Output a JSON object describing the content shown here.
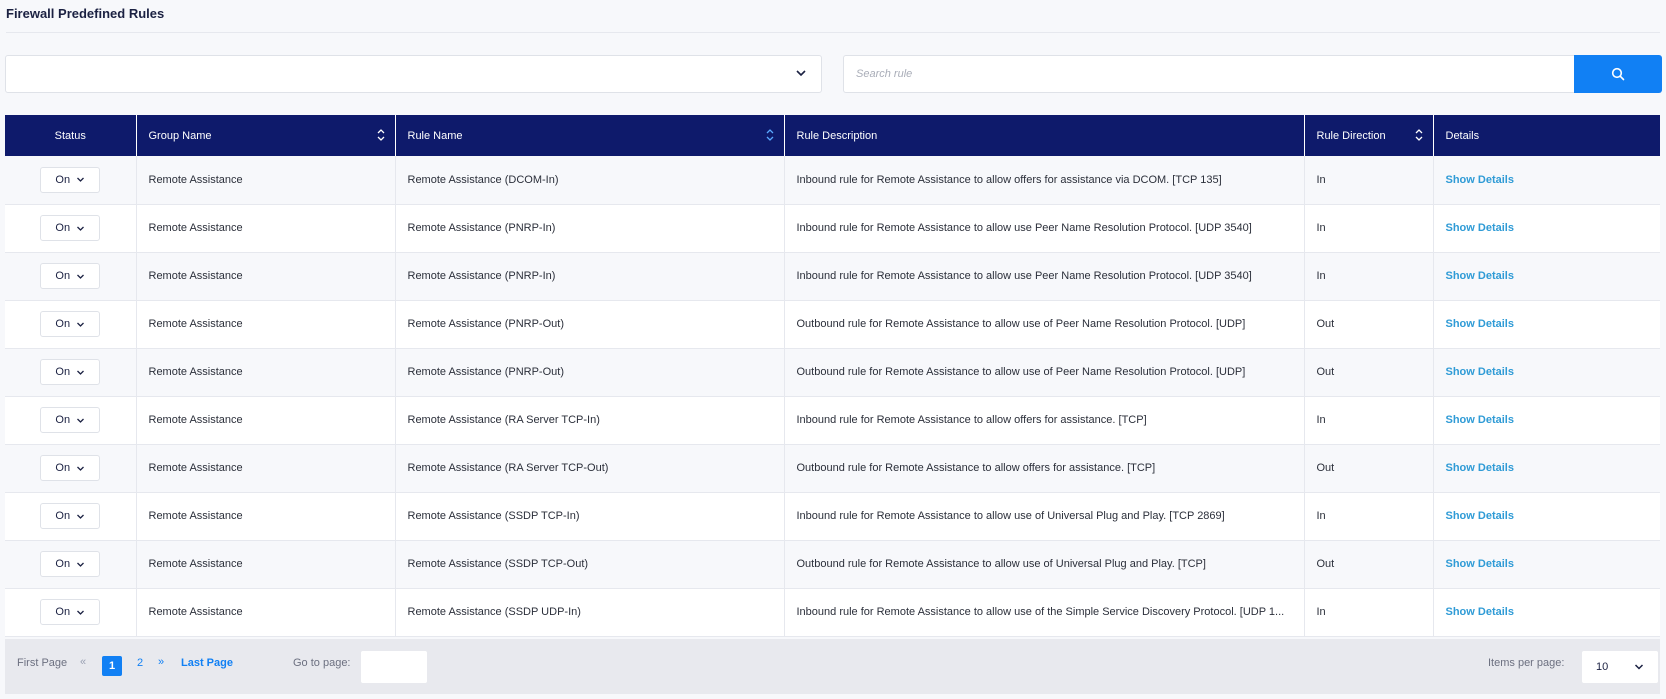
{
  "page": {
    "title": "Firewall Predefined Rules"
  },
  "filters": {
    "group_select_value": "",
    "search_placeholder": "Search rule",
    "search_icon": "search-icon"
  },
  "table": {
    "columns": [
      "Status",
      "Group Name",
      "Rule Name",
      "Rule Description",
      "Rule Direction",
      "Details"
    ],
    "rows": [
      {
        "status": "On",
        "group": "Remote Assistance",
        "rule": "Remote Assistance (DCOM-In)",
        "description": "Inbound rule for Remote Assistance to allow offers for assistance via DCOM. [TCP 135]",
        "direction": "In",
        "details": "Show Details"
      },
      {
        "status": "On",
        "group": "Remote Assistance",
        "rule": "Remote Assistance (PNRP-In)",
        "description": "Inbound rule for Remote Assistance to allow use Peer Name Resolution Protocol. [UDP 3540]",
        "direction": "In",
        "details": "Show Details"
      },
      {
        "status": "On",
        "group": "Remote Assistance",
        "rule": "Remote Assistance (PNRP-In)",
        "description": "Inbound rule for Remote Assistance to allow use Peer Name Resolution Protocol. [UDP 3540]",
        "direction": "In",
        "details": "Show Details"
      },
      {
        "status": "On",
        "group": "Remote Assistance",
        "rule": "Remote Assistance (PNRP-Out)",
        "description": "Outbound rule for Remote Assistance to allow use of Peer Name Resolution Protocol. [UDP]",
        "direction": "Out",
        "details": "Show Details"
      },
      {
        "status": "On",
        "group": "Remote Assistance",
        "rule": "Remote Assistance (PNRP-Out)",
        "description": "Outbound rule for Remote Assistance to allow use of Peer Name Resolution Protocol. [UDP]",
        "direction": "Out",
        "details": "Show Details"
      },
      {
        "status": "On",
        "group": "Remote Assistance",
        "rule": "Remote Assistance (RA Server TCP-In)",
        "description": "Inbound rule for Remote Assistance to allow offers for assistance. [TCP]",
        "direction": "In",
        "details": "Show Details"
      },
      {
        "status": "On",
        "group": "Remote Assistance",
        "rule": "Remote Assistance (RA Server TCP-Out)",
        "description": "Outbound rule for Remote Assistance to allow offers for assistance. [TCP]",
        "direction": "Out",
        "details": "Show Details"
      },
      {
        "status": "On",
        "group": "Remote Assistance",
        "rule": "Remote Assistance (SSDP TCP-In)",
        "description": "Inbound rule for Remote Assistance to allow use of Universal Plug and Play. [TCP 2869]",
        "direction": "In",
        "details": "Show Details"
      },
      {
        "status": "On",
        "group": "Remote Assistance",
        "rule": "Remote Assistance (SSDP TCP-Out)",
        "description": "Outbound rule for Remote Assistance to allow use of Universal Plug and Play. [TCP]",
        "direction": "Out",
        "details": "Show Details"
      },
      {
        "status": "On",
        "group": "Remote Assistance",
        "rule": "Remote Assistance (SSDP UDP-In)",
        "description": "Inbound rule for Remote Assistance to allow use of the Simple Service Discovery Protocol. [UDP 1...",
        "direction": "In",
        "details": "Show Details"
      }
    ]
  },
  "pagination": {
    "first_label": "First Page",
    "prev_glyph": "«",
    "pages": [
      "1",
      "2"
    ],
    "current_page": "1",
    "next_glyph": "»",
    "last_label": "Last Page",
    "goto_label": "Go to page:",
    "goto_value": "",
    "items_per_page_label": "Items per page:",
    "items_per_page_value": "10"
  },
  "colors": {
    "header_bg": "#0e1a6b",
    "accent": "#1180f4",
    "link": "#2f9bd6"
  }
}
